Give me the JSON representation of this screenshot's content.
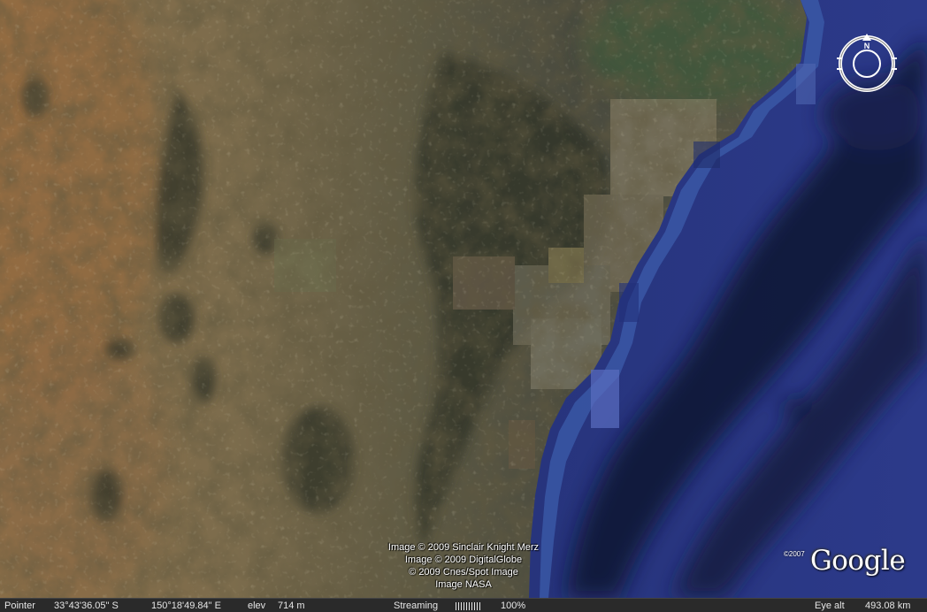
{
  "attribution": {
    "lines": [
      "Image © 2009 Sinclair Knight Merz",
      "Image © 2009 DigitalGlobe",
      "© 2009 Cnes/Spot Image",
      "Image NASA"
    ]
  },
  "logo": {
    "copyright": "©2007",
    "name": "Google"
  },
  "compass": {
    "north_label": "N"
  },
  "status": {
    "pointer_label": "Pointer",
    "latitude": "33°43'36.05\" S",
    "longitude": "150°18'49.84\" E",
    "elev_label": "elev",
    "elev_value": "714 m",
    "streaming_label": "Streaming",
    "streaming_percent": "100%",
    "streaming_progress": 1.0,
    "eye_alt_label": "Eye alt",
    "eye_alt_value": "493.08 km"
  },
  "colors": {
    "land_inland": "#7a6a48",
    "land_forest": "#3e4236",
    "ocean": "#2c3c8c",
    "ocean_deep": "#151e48",
    "statusbar_bg": "#2a2a2a"
  }
}
